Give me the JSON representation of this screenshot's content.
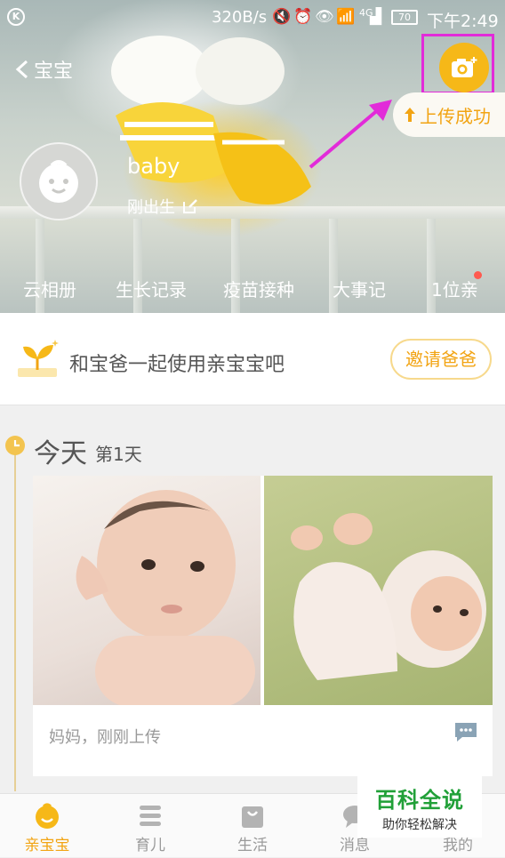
{
  "status_bar": {
    "speed": "320B/s",
    "network": "4G",
    "battery": "70",
    "time": "下午2:49"
  },
  "header": {
    "back_label": "宝宝",
    "upload_toast": "上传成功"
  },
  "profile": {
    "name": "baby",
    "age": "刚出生"
  },
  "hero_tabs": [
    "云相册",
    "生长记录",
    "疫苗接种",
    "大事记",
    "1位亲"
  ],
  "invite": {
    "text": "和宝爸一起使用亲宝宝吧",
    "button": "邀请爸爸"
  },
  "timeline": {
    "day_title": "今天",
    "day_count": "第1天",
    "post": {
      "caption": "妈妈，刚刚上传"
    }
  },
  "watermark": {
    "title": "百科全说",
    "subtitle": "助你轻松解决"
  },
  "bottom_nav": [
    {
      "label": "亲宝宝",
      "icon": "baby-face-icon",
      "active": true
    },
    {
      "label": "育儿",
      "icon": "menu-lines-icon",
      "active": false
    },
    {
      "label": "生活",
      "icon": "shopping-bag-icon",
      "active": false
    },
    {
      "label": "消息",
      "icon": "chat-bubble-icon",
      "active": false
    },
    {
      "label": "我的",
      "icon": "person-icon",
      "active": false
    }
  ],
  "colors": {
    "accent": "#f2a413",
    "camera_button": "#f6b818",
    "highlight": "#e22bd9",
    "watermark": "#21a038"
  }
}
